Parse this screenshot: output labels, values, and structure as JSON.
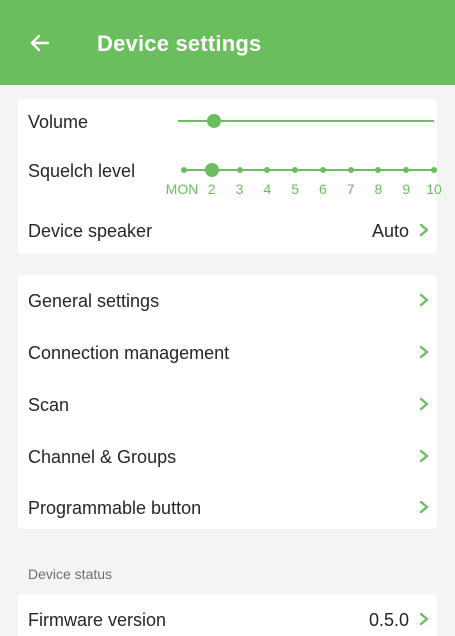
{
  "app_bar": {
    "title": "Device settings",
    "back_icon": "arrow-left-icon",
    "color": "#6bbe5d"
  },
  "audio_card": {
    "volume": {
      "label": "Volume",
      "level_fraction": 0.14
    },
    "squelch": {
      "label": "Squelch level",
      "ticks": [
        "MON",
        "2",
        "3",
        "4",
        "5",
        "6",
        "7",
        "8",
        "9",
        "10"
      ],
      "selected_index": 1
    },
    "device_speaker": {
      "label": "Device speaker",
      "value": "Auto"
    }
  },
  "menu_items": [
    {
      "label": "General settings"
    },
    {
      "label": "Connection management"
    },
    {
      "label": "Scan"
    },
    {
      "label": "Channel & Groups"
    },
    {
      "label": "Programmable button"
    }
  ],
  "device_status": {
    "section_title": "Device status",
    "firmware": {
      "label": "Firmware version",
      "value": "0.5.0"
    }
  }
}
